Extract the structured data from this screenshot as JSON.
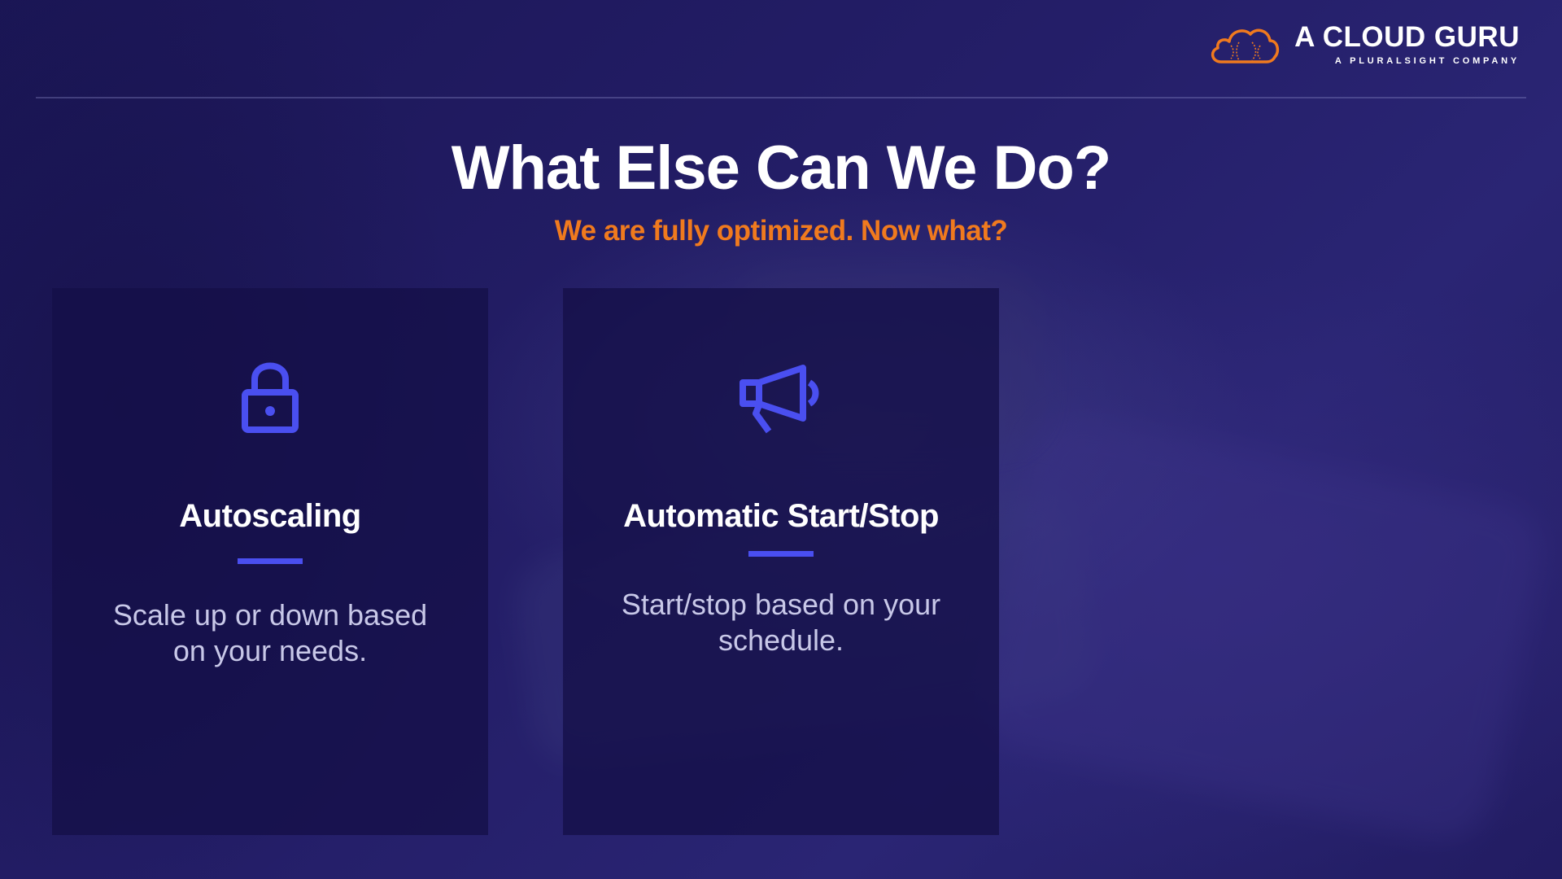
{
  "brand": {
    "name": "A CLOUD GURU",
    "tagline": "A PLURALSIGHT COMPANY",
    "accent_color": "#f07a1e"
  },
  "slide": {
    "title": "What Else Can We Do?",
    "subtitle": "We are fully optimized. Now what?"
  },
  "cards": [
    {
      "icon": "lock-icon",
      "title": "Autoscaling",
      "description": "Scale up or down based on your needs."
    },
    {
      "icon": "megaphone-icon",
      "title": "Automatic Start/Stop",
      "description": "Start/stop based on your schedule."
    }
  ],
  "colors": {
    "background": "#1f1a5c",
    "card_background": "#141048",
    "icon_blue": "#4a4ff0",
    "title_white": "#ffffff",
    "subtitle_orange": "#f07a1e"
  }
}
